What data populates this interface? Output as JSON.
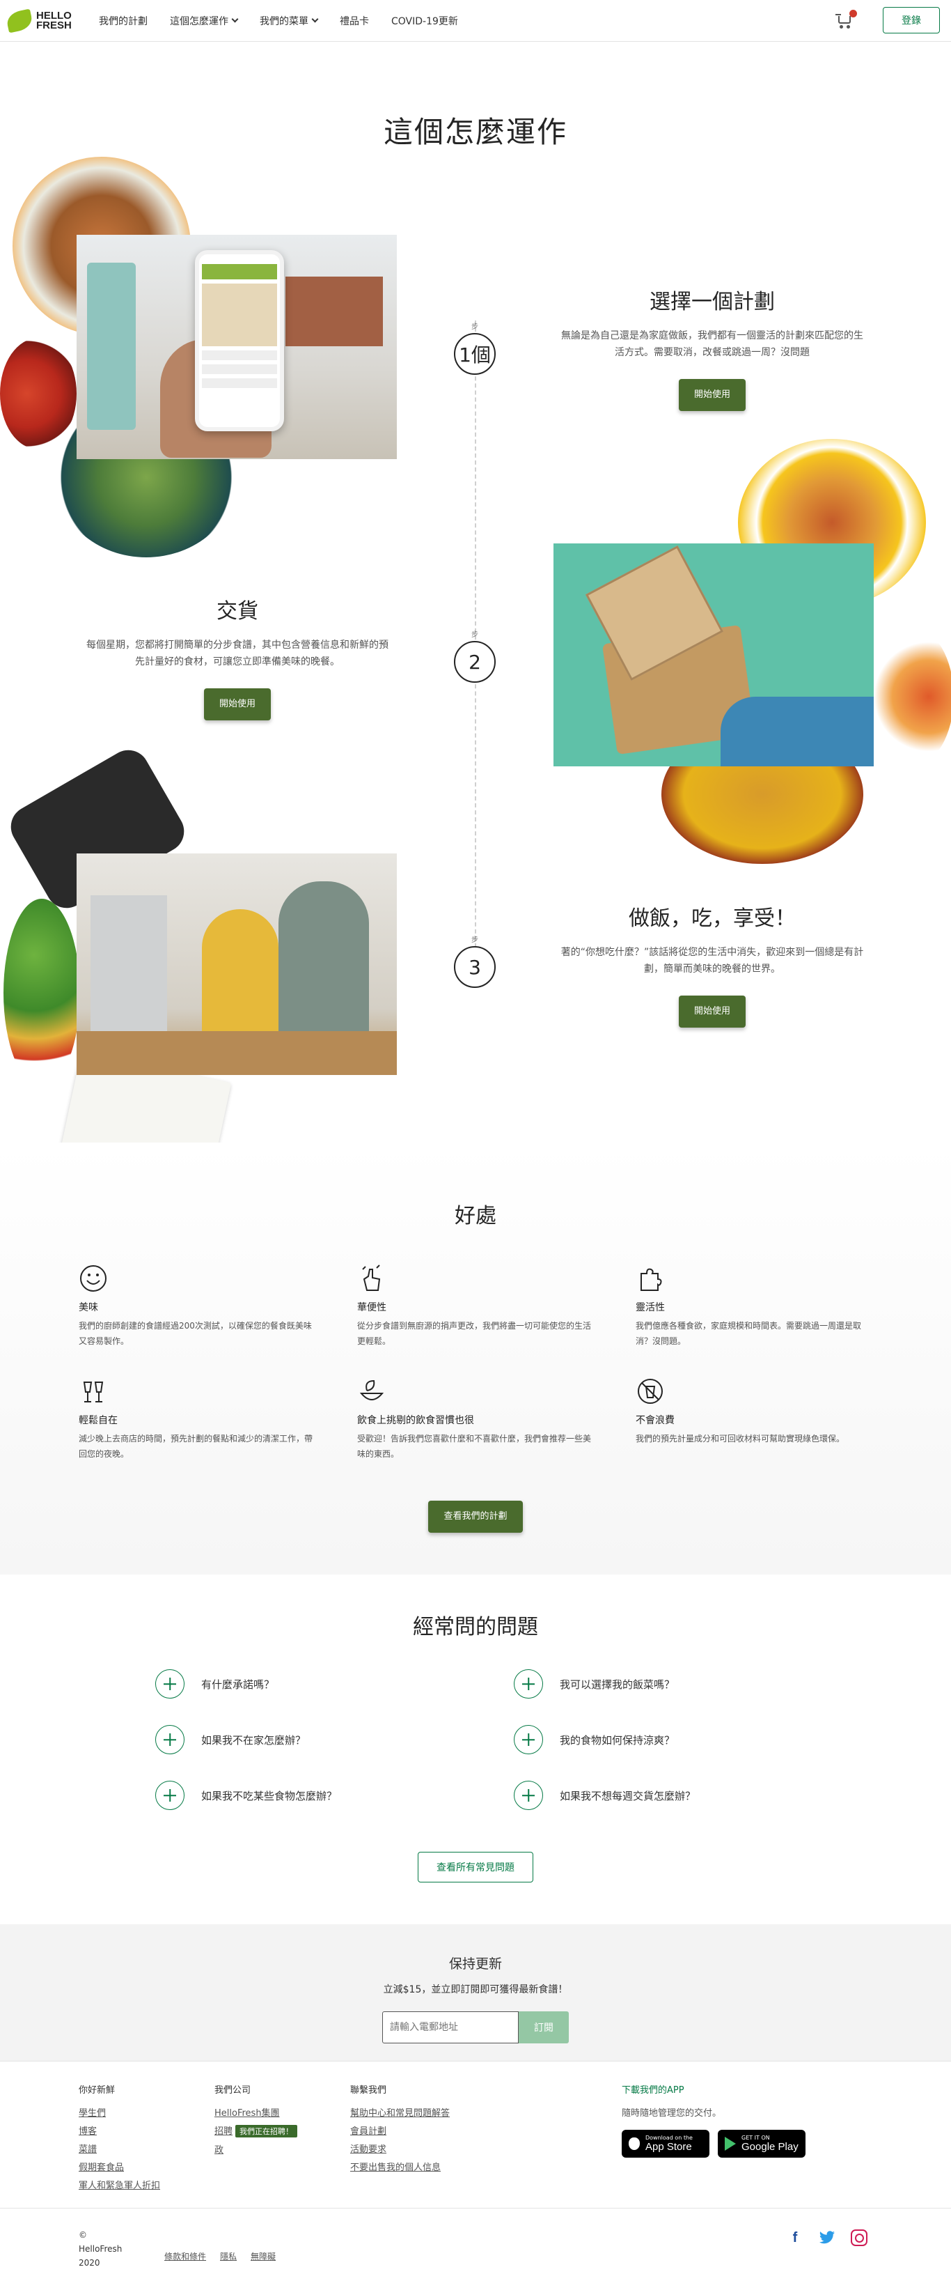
{
  "header": {
    "logo_line1": "HELLO",
    "logo_line2": "FRESH",
    "nav": [
      {
        "label": "我們的計劃"
      },
      {
        "label": "這個怎麼運作"
      },
      {
        "label": "我們的菜單"
      },
      {
        "label": "禮品卡"
      },
      {
        "label": "COVID-19更新"
      }
    ],
    "login_label": "登錄"
  },
  "how": {
    "title": "這個怎麼運作",
    "steps": [
      {
        "number": "1個",
        "sub": "步",
        "title": "選擇一個計劃",
        "desc": "無論是為自己還是為家庭做飯，我們都有一個靈活的計劃來匹配您的生活方式。需要取消，改餐或跳過一周？沒問題",
        "cta": "開始使用"
      },
      {
        "number": "2",
        "sub": "步",
        "title": "交貨",
        "desc": "每個星期，您都將打開簡單的分步食譜，其中包含營養信息和新鮮的預先計量好的食材，可讓您立即準備美味的晚餐。",
        "cta": "開始使用"
      },
      {
        "number": "3",
        "sub": "步",
        "title": "做飯，吃，享受！",
        "desc": "著的“你想吃什麼？”該話將從您的生活中消失，歡迎來到一個總是有計劃，簡單而美味的晚餐的世界。",
        "cta": "開始使用"
      }
    ]
  },
  "benefits": {
    "title": "好處",
    "items": [
      {
        "icon": "smile-icon",
        "title": "美味",
        "desc": "我們的廚師創建的食譜經過200次測試，以確保您的餐食既美味又容易製作。"
      },
      {
        "icon": "hand-tap-icon",
        "title": "華便性",
        "desc": "從分步食譜到無廚源的捐声更改，我們將盡一切可能使您的生活更輕鬆。"
      },
      {
        "icon": "puzzle-icon",
        "title": "靈活性",
        "desc": "我們億應各種食欲，家庭規模和時間表。需要跳過一周還是取消？沒問題。"
      },
      {
        "icon": "cheers-icon",
        "title": "輕鬆自在",
        "desc": "減少晚上去商店的時間，預先計劃的餐點和減少的清潔工作，帶回您的夜晚。"
      },
      {
        "icon": "leaf-bowl-icon",
        "title": "飲食上挑剔的飲食習慣也很",
        "desc": "受歡迎！告訴我們您喜歡什麼和不喜歡什麼，我們會推荐一些美味的東西。"
      },
      {
        "icon": "no-waste-icon",
        "title": "不會浪費",
        "desc": "我們的預先計量成分和可回收材料可幫助實現綠色環保。"
      }
    ],
    "cta": "查看我們的計劃"
  },
  "faq": {
    "title": "經常問的問題",
    "items": [
      {
        "q": "有什麼承諾嗎？"
      },
      {
        "q": "我可以選擇我的飯菜嗎？"
      },
      {
        "q": "如果我不在家怎麼辦？"
      },
      {
        "q": "我的食物如何保持涼爽？"
      },
      {
        "q": "如果我不吃某些食物怎麼辦？"
      },
      {
        "q": "如果我不想每週交貨怎麼辦？"
      }
    ],
    "cta": "查看所有常見問題"
  },
  "newsletter": {
    "title": "保持更新",
    "subtitle": "立減$15，並立即訂閱即可獲得最新食譜！",
    "placeholder": "請輸入電郵地址",
    "button": "訂閱"
  },
  "footer": {
    "cols": [
      {
        "title": "你好新鮮",
        "links": [
          "學生們",
          "博客",
          "菜譜",
          "假期套食品",
          "軍人和緊急軍人折扣"
        ]
      },
      {
        "title": "我們公司",
        "links": [
          "HelloFresh集團",
          "招聘",
          "政"
        ],
        "badge": "我們正在招聘！"
      },
      {
        "title": "聯繫我們",
        "links": [
          "幫助中心和常見問題解答",
          "會員計劃",
          "活動要求",
          "不要出售我的個人信息"
        ]
      }
    ],
    "app": {
      "title": "下載我們的APP",
      "desc": "隨時隨地管理您的交付。",
      "appstore_small": "Download on the",
      "appstore_big": "App Store",
      "play_small": "GET IT ON",
      "play_big": "Google Play"
    },
    "copyright_symbol": "©",
    "copyright_name": "HelloFresh",
    "copyright_year": "2020",
    "legal": [
      "條款和條件",
      "隱私",
      "無障礙"
    ]
  },
  "colors": {
    "brand_green": "#067a46",
    "button_green": "#4a6b2d",
    "logo_lime": "#91c11e"
  }
}
